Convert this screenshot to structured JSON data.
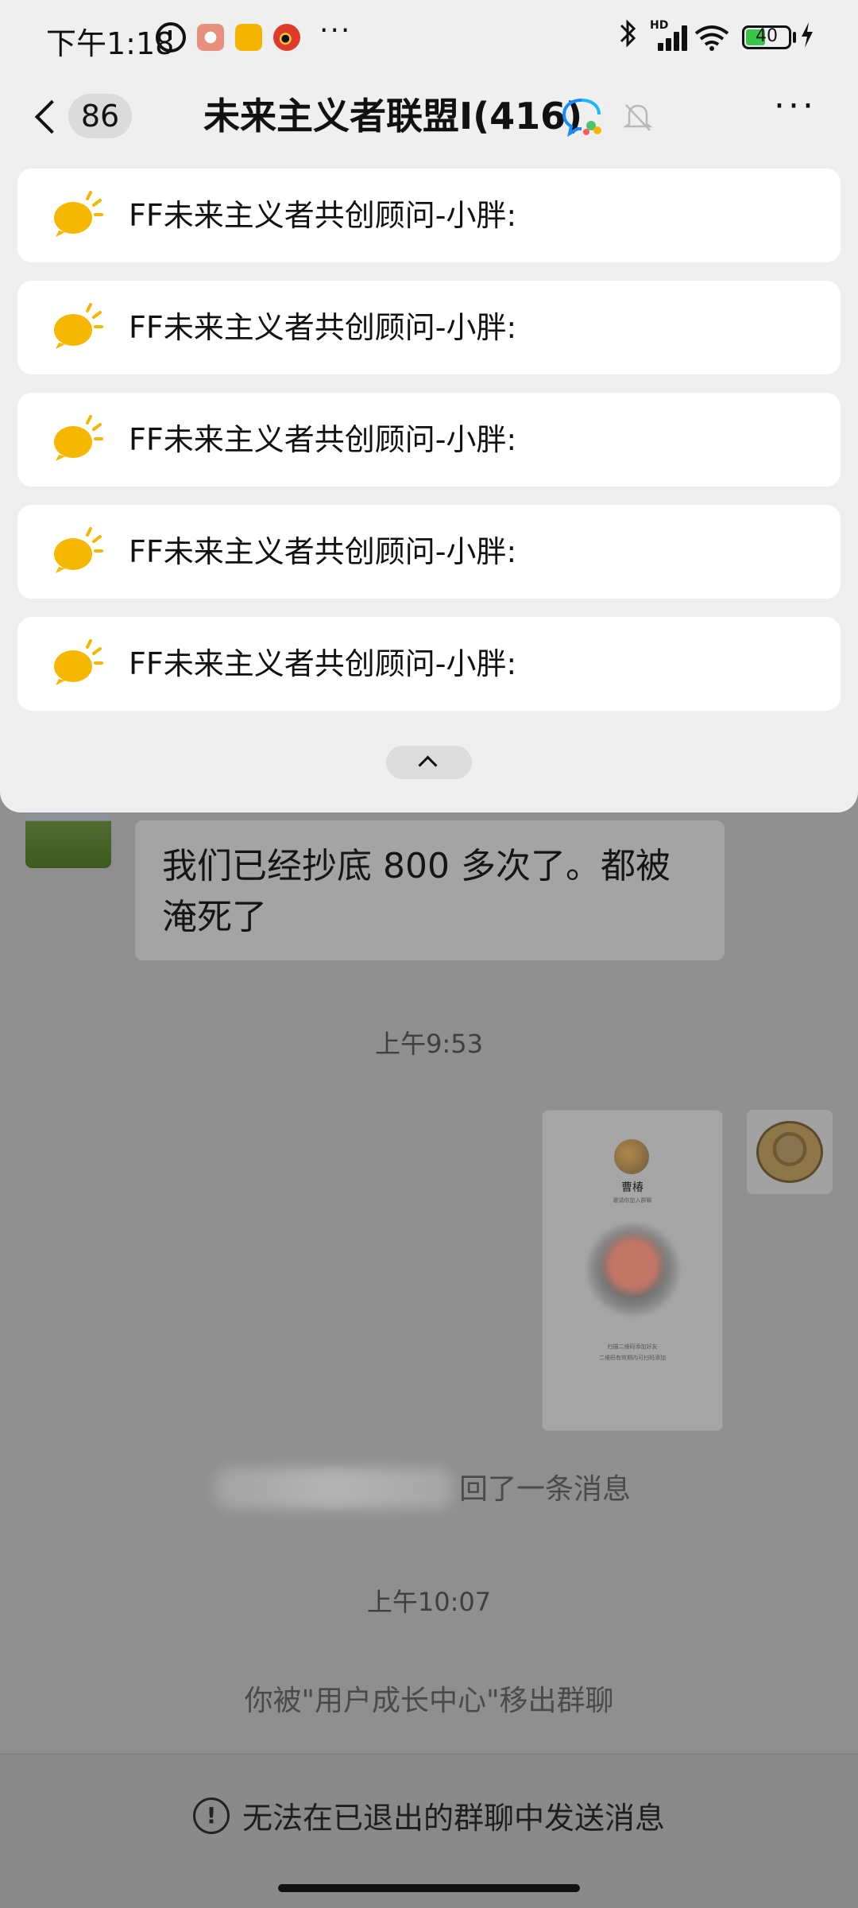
{
  "status_bar": {
    "time": "下午1:18",
    "more": "···",
    "network": "HD",
    "battery": "40",
    "icons": [
      "alarm-icon",
      "app-icon",
      "app-icon",
      "weibo-icon",
      "bluetooth-icon",
      "signal-icon",
      "wifi-icon",
      "battery-icon",
      "charging-icon"
    ]
  },
  "header": {
    "unread_count": "86",
    "title": "未来主义者联盟I(416)",
    "more_label": "···"
  },
  "pinned": {
    "items": [
      {
        "text": "FF未来主义者共创顾问-小胖:"
      },
      {
        "text": "FF未来主义者共创顾问-小胖:"
      },
      {
        "text": "FF未来主义者共创顾问-小胖:"
      },
      {
        "text": "FF未来主义者共创顾问-小胖:"
      },
      {
        "text": "FF未来主义者共创顾问-小胖:"
      }
    ]
  },
  "messages": {
    "text_message": "我们已经抄底 800 多次了。都被淹死了",
    "time_1": "上午9:53",
    "card": {
      "name": "曹椿",
      "subtitle": "邀请你加入群聊",
      "footer_1": "扫描二维码添加好友",
      "footer_2": "二维码有效期内可扫码添加"
    },
    "recall_notice": "回了一条消息",
    "time_2": "上午10:07",
    "removed_notice": "你被\"用户成长中心\"移出群聊"
  },
  "bottom": {
    "notice": "无法在已退出的群聊中发送消息",
    "icon": "!"
  },
  "colors": {
    "accent_yellow": "#f5b700",
    "dim_overlay": "#8f8f8f",
    "panel_bg": "#efefef"
  }
}
